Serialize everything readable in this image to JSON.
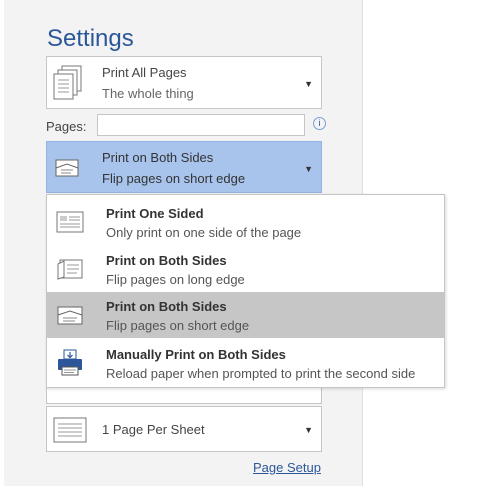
{
  "colors": {
    "accent": "#2b579a",
    "selected_combo": "#a8c4ec",
    "selected_option": "#c6c6c6"
  },
  "settings": {
    "title": "Settings"
  },
  "print_pages": {
    "line1": "Print All Pages",
    "line2": "The whole thing",
    "icon": "pages-icon"
  },
  "pages": {
    "label": "Pages:",
    "value": "",
    "info_icon": "info-icon"
  },
  "both_sides": {
    "line1": "Print on Both Sides",
    "line2": "Flip pages on short edge",
    "icon": "duplex-short-edge-icon"
  },
  "dropdown": {
    "options": [
      {
        "title": "Print One Sided",
        "subtitle": "Only print on one side of the page",
        "icon": "one-sided-icon",
        "selected": false
      },
      {
        "title": "Print on Both Sides",
        "subtitle": "Flip pages on long edge",
        "icon": "duplex-long-edge-icon",
        "selected": false
      },
      {
        "title": "Print on Both Sides",
        "subtitle": "Flip pages on short edge",
        "icon": "duplex-short-edge-icon",
        "selected": true
      },
      {
        "title": "Manually Print on Both Sides",
        "subtitle": "Reload paper when prompted to print the second side",
        "icon": "manual-duplex-printer-icon",
        "selected": false
      }
    ]
  },
  "pages_per_sheet": {
    "line1": "1 Page Per Sheet",
    "icon": "sheet-icon"
  },
  "page_setup": {
    "label": "Page Setup"
  }
}
